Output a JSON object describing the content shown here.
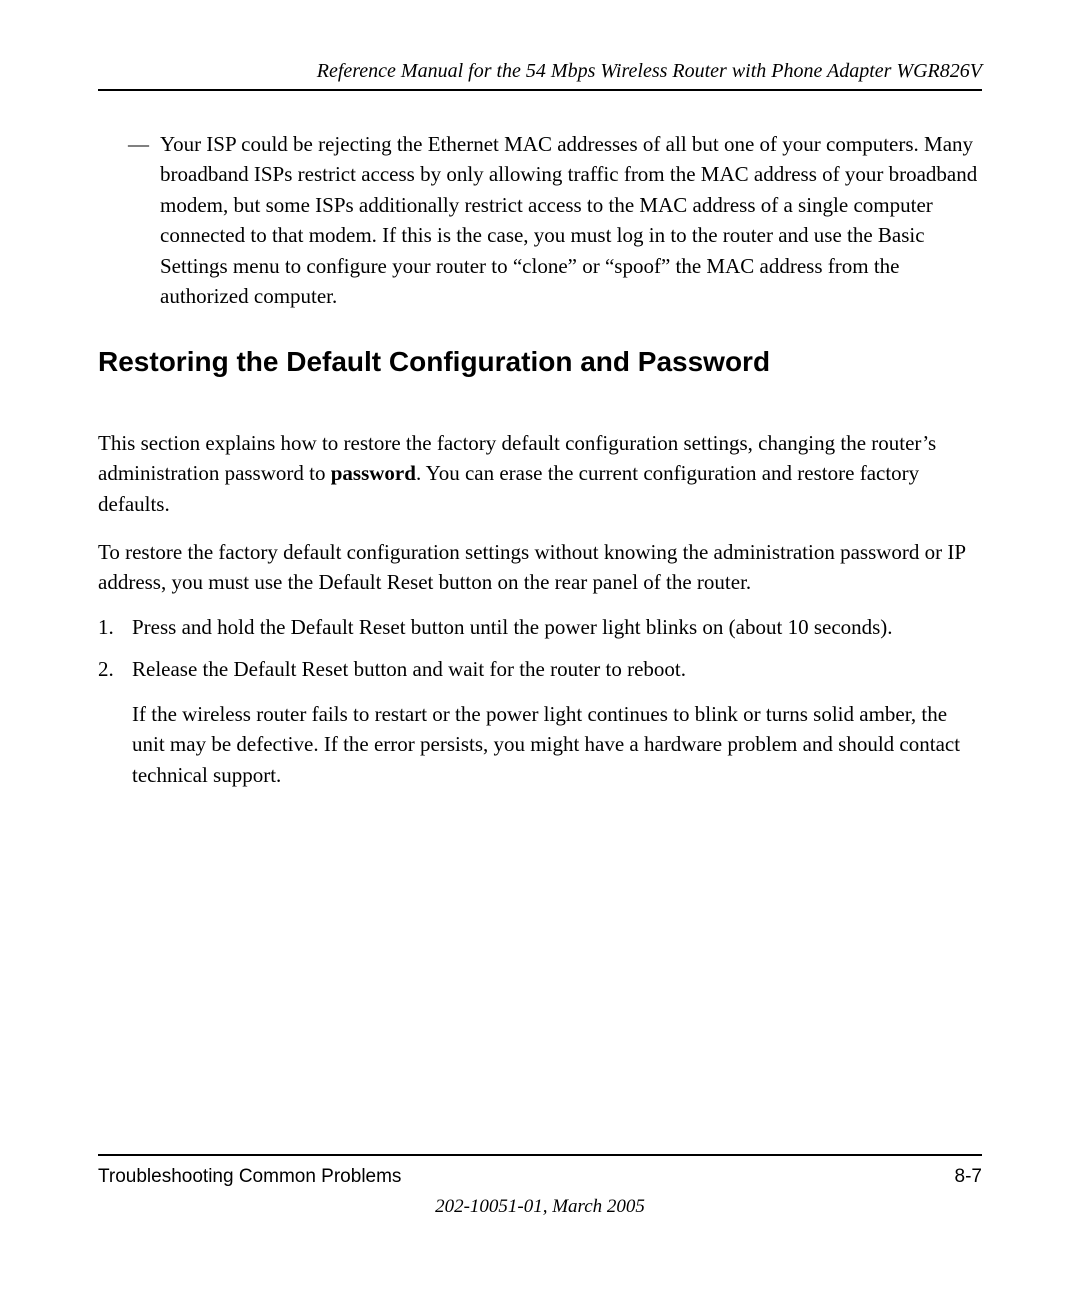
{
  "header": {
    "title": "Reference Manual for the 54 Mbps Wireless Router with Phone Adapter WGR826V"
  },
  "bullet": {
    "marker": "—",
    "text": "Your ISP could be rejecting the Ethernet MAC addresses of all but one of your computers. Many broadband ISPs restrict access by only allowing traffic from the MAC address of your broadband modem, but some ISPs additionally restrict access to the MAC address of a single computer connected to that modem. If this is the case, you must log in to the router and use the Basic Settings menu to configure your router to “clone” or “spoof” the MAC address from the authorized computer."
  },
  "heading": "Restoring the Default Configuration and Password",
  "intro": {
    "part1": "This section explains how to restore the factory default configuration settings, changing the router’s administration password to ",
    "bold": "password",
    "part2": ". You can erase the current configuration and restore factory defaults."
  },
  "para2": "To restore the factory default configuration settings without knowing the administration password or IP address, you must use the Default Reset button on the rear panel of the router.",
  "steps": [
    {
      "num": "1.",
      "text": "Press and hold the Default Reset button until the power light blinks on (about 10 seconds)."
    },
    {
      "num": "2.",
      "text": "Release the Default Reset button and wait for the router to reboot."
    }
  ],
  "substep": "If the wireless router fails to restart or the power light continues to blink or turns solid amber, the unit may be defective. If the error persists, you might have a hardware problem and should contact technical support.",
  "footer": {
    "left": "Troubleshooting Common Problems",
    "right": "8-7",
    "center": "202-10051-01, March 2005"
  }
}
